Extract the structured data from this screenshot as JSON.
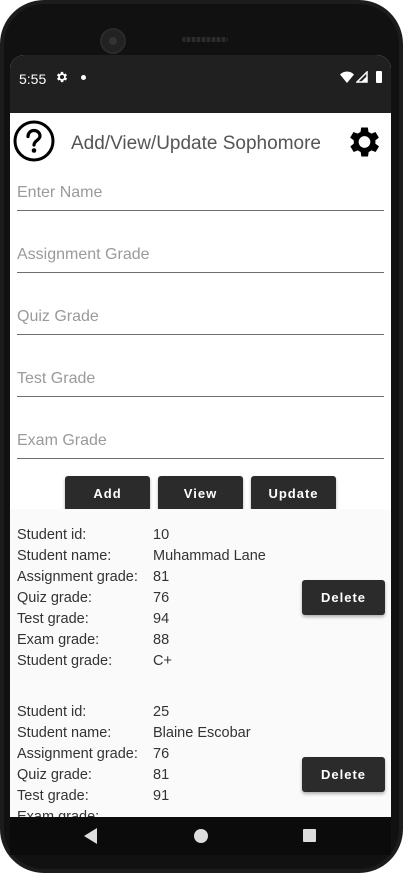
{
  "status": {
    "time": "5:55"
  },
  "appbar": {
    "title": "Add/View/Update Sophomore"
  },
  "form": {
    "name_placeholder": "Enter Name",
    "assignment_placeholder": "Assignment Grade",
    "quiz_placeholder": "Quiz Grade",
    "test_placeholder": "Test Grade",
    "exam_placeholder": "Exam Grade"
  },
  "buttons": {
    "add": "Add",
    "view": "View",
    "update": "Update"
  },
  "labels": {
    "id": "Student id:",
    "name": "Student name:",
    "assignment": "Assignment grade:",
    "quiz": "Quiz grade:",
    "test": "Test grade:",
    "exam": "Exam grade:",
    "grade": "Student grade:"
  },
  "students": [
    {
      "id": "10",
      "name": "Muhammad Lane",
      "assignment": "81",
      "quiz": "76",
      "test": "94",
      "exam": "88",
      "grade": "C+",
      "delete_label": "Delete"
    },
    {
      "id": "25",
      "name": "Blaine Escobar",
      "assignment": "76",
      "quiz": "81",
      "test": "91",
      "exam": "",
      "grade": "",
      "delete_label": "Delete"
    }
  ]
}
